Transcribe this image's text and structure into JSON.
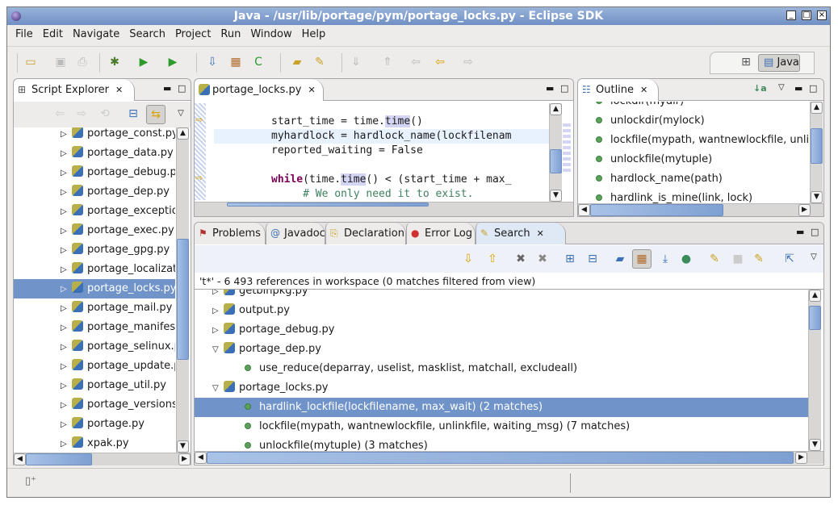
{
  "window": {
    "title": "Java - /usr/lib/portage/pym/portage_locks.py - Eclipse SDK"
  },
  "menu": [
    "File",
    "Edit",
    "Navigate",
    "Search",
    "Project",
    "Run",
    "Window",
    "Help"
  ],
  "perspective": {
    "label": "Java"
  },
  "explorer": {
    "tab": "Script Explorer",
    "selected_index": 8,
    "items": [
      "portage_const.py",
      "portage_data.py",
      "portage_debug.py",
      "portage_dep.py",
      "portage_exception.py",
      "portage_exec.py",
      "portage_gpg.py",
      "portage_localization.py",
      "portage_locks.py",
      "portage_mail.py",
      "portage_manifest.py",
      "portage_selinux.py",
      "portage_update.py",
      "portage_util.py",
      "portage_versions.py",
      "portage.py",
      "xpak.py"
    ]
  },
  "editor": {
    "tab": "portage_locks.py",
    "lines": [
      {
        "parts": [
          [
            "",
            "start_time = time."
          ],
          [
            "hl",
            "time"
          ],
          [
            "",
            "()"
          ]
        ]
      },
      {
        "parts": [
          [
            "",
            "myhardlock = hardlock_name(lockfilenam"
          ]
        ]
      },
      {
        "parts": [
          [
            "",
            "reported_waiting = False"
          ]
        ]
      },
      {
        "parts": []
      },
      {
        "parts": [
          [
            "kw",
            "while"
          ],
          [
            "",
            "(time."
          ],
          [
            "hl",
            "time"
          ],
          [
            "",
            "() < (start_time + max_"
          ]
        ]
      },
      {
        "parts": [
          [
            "cm",
            "     # We only need it to exist."
          ]
        ]
      }
    ]
  },
  "outline": {
    "tab": "Outline",
    "items": [
      "lockdir(mydir)",
      "unlockdir(mylock)",
      "lockfile(mypath, wantnewlockfile, unlinkfile, waiting_msg)",
      "unlockfile(mytuple)",
      "hardlock_name(path)",
      "hardlink_is_mine(link, lock)"
    ]
  },
  "bottom": {
    "tabs": [
      {
        "label": "Problems",
        "icon": "problems-icon"
      },
      {
        "label": "Javadoc",
        "icon": "at-icon"
      },
      {
        "label": "Declaration",
        "icon": "declaration-icon"
      },
      {
        "label": "Error Log",
        "icon": "error-log-icon"
      },
      {
        "label": "Search",
        "icon": "search-flashlight-icon"
      }
    ],
    "active": "Search"
  },
  "search": {
    "summary": "'t*' - 6 493 references in workspace (0 matches filtered from view)",
    "selected_index": 6,
    "rows": [
      {
        "text": "getbinpkg.py",
        "type": "file",
        "expanded": false
      },
      {
        "text": "output.py",
        "type": "file",
        "expanded": false
      },
      {
        "text": "portage_debug.py",
        "type": "file",
        "expanded": false
      },
      {
        "text": "portage_dep.py",
        "type": "file",
        "expanded": true
      },
      {
        "text": "use_reduce(deparray, uselist, masklist, matchall, excludeall)",
        "type": "func"
      },
      {
        "text": "portage_locks.py",
        "type": "file",
        "expanded": true
      },
      {
        "text": "hardlink_lockfile(lockfilename, max_wait) (2 matches)",
        "type": "func"
      },
      {
        "text": "lockfile(mypath, wantnewlockfile, unlinkfile, waiting_msg) (7 matches)",
        "type": "func"
      },
      {
        "text": "unlockfile(mytuple) (3 matches)",
        "type": "func"
      }
    ]
  },
  "colors": {
    "selection": "#7094ca",
    "titlebar": "#6f8fc4",
    "keyword": "#7f0055",
    "comment": "#3f7f5f"
  }
}
